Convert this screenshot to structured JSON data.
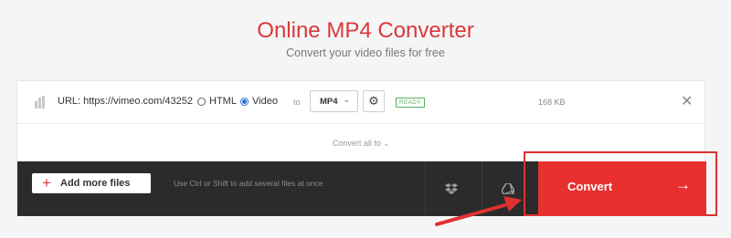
{
  "header": {
    "title": "Online MP4 Converter",
    "subtitle": "Convert your video files for free"
  },
  "file_row": {
    "url_text": "URL: https://vimeo.com/43252",
    "radio_options": [
      {
        "label": "HTML",
        "checked": false
      },
      {
        "label": "Video",
        "checked": true
      }
    ],
    "to_label": "to",
    "format_value": "MP4",
    "status_badge": "READY",
    "file_size": "168 KB"
  },
  "convert_all": {
    "label": "Convert all to"
  },
  "action_bar": {
    "add_more_label": "Add more files",
    "hint_text": "Use Ctrl or Shift to add several files at once",
    "convert_label": "Convert"
  },
  "colors": {
    "brand_red": "#d9383b",
    "convert_red": "#e8312f",
    "ready_green": "#58b25a",
    "dark_bar": "#2b2b2b"
  },
  "icons": [
    "file-icon",
    "gear-icon",
    "close-icon",
    "chevron-down-icon",
    "plus-icon",
    "dropbox-icon",
    "google-drive-icon",
    "arrow-right-icon"
  ]
}
